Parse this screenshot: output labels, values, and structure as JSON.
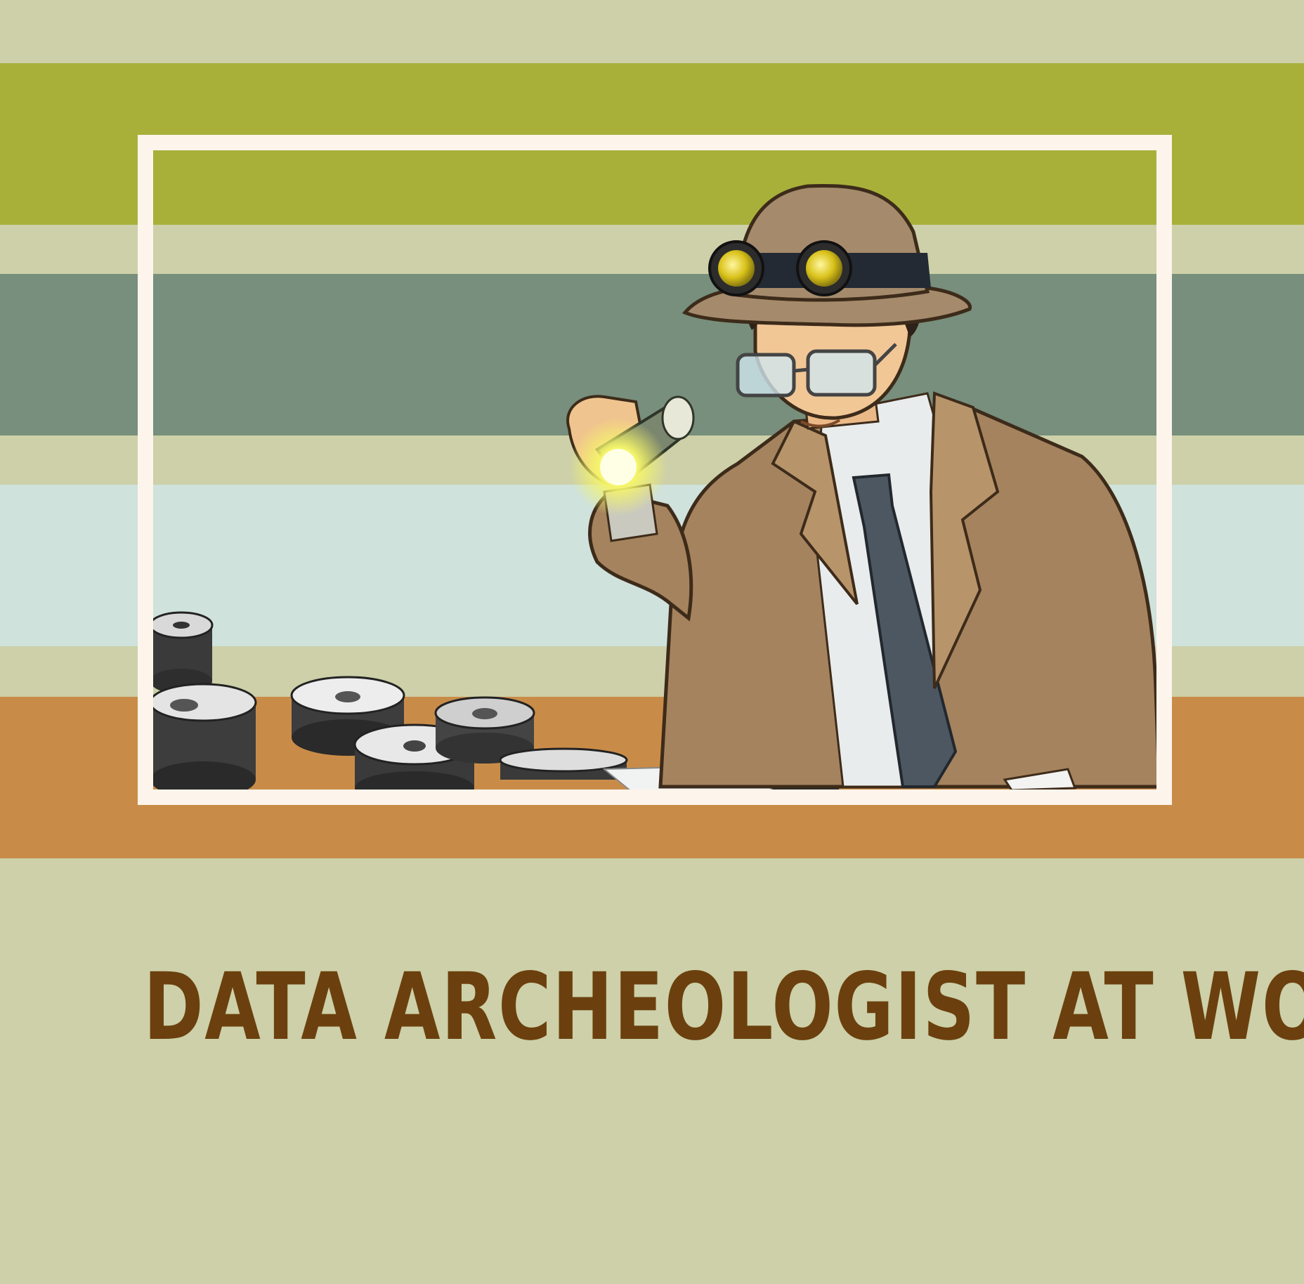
{
  "caption": "DATA ARCHEOLOGIST AT WORK",
  "colors": {
    "pale_sage": "#cdd0a8",
    "olive": "#a8b03a",
    "slate_green": "#778f7c",
    "pale_blue": "#cfe2dc",
    "ochre": "#c98c48",
    "frame": "#fdf4ec",
    "caption_brown": "#6b400e"
  },
  "stripes": [
    "pale_sage",
    "olive",
    "pale_sage",
    "slate_green",
    "pale_sage",
    "pale_blue",
    "pale_sage",
    "ochre",
    "pale_sage"
  ]
}
